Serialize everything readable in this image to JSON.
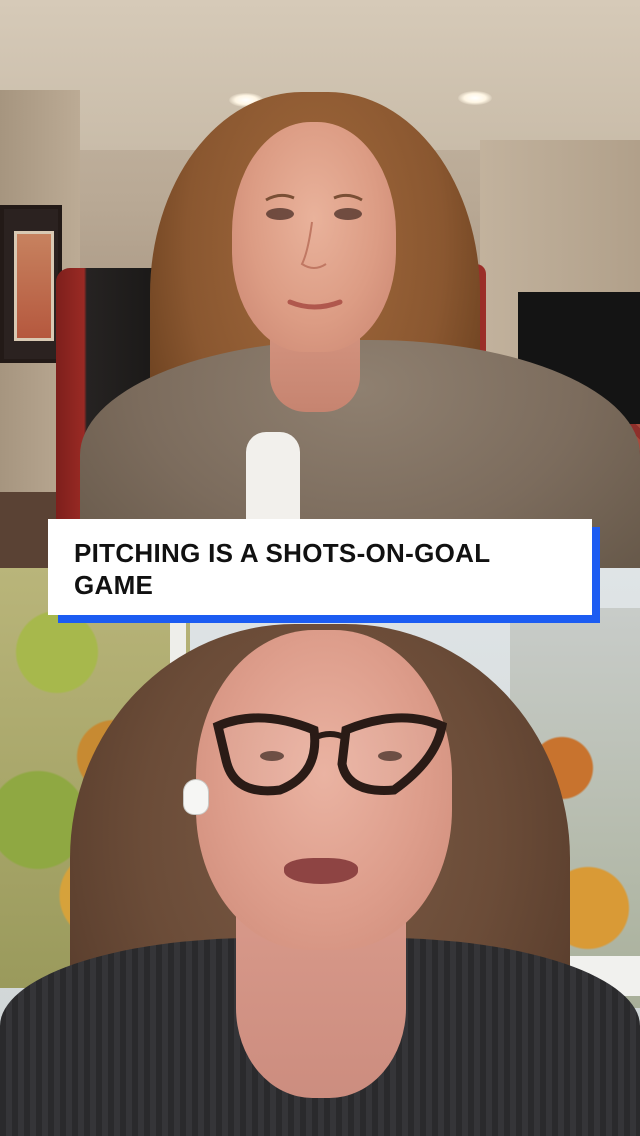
{
  "caption": {
    "text": "PITCHING IS A SHOTS-ON-GOAL GAME",
    "accent_color": "#1c5cf2"
  },
  "layout": {
    "panels": [
      "top-participant-video",
      "bottom-participant-video"
    ]
  }
}
